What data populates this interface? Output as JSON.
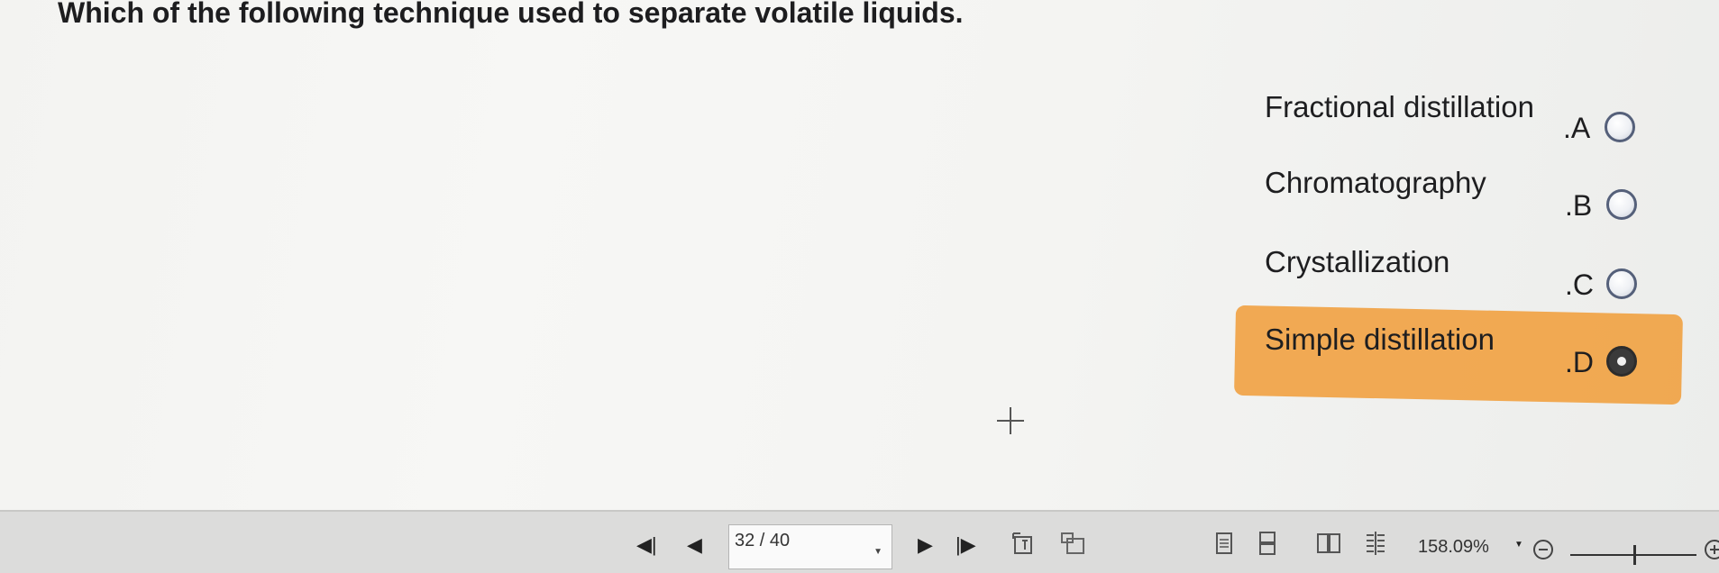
{
  "question": "Which of the following technique used to separate volatile liquids.",
  "options": [
    {
      "text": "Fractional distillation",
      "letter": ".A",
      "selected": false
    },
    {
      "text": "Chromatography",
      "letter": ".B",
      "selected": false
    },
    {
      "text": "Crystallization",
      "letter": ".C",
      "selected": false
    },
    {
      "text": "Simple distillation",
      "letter": ".D",
      "selected": true
    }
  ],
  "toolbar": {
    "first_page": "◀|",
    "prev_page": "◀",
    "page_indicator": "32 / 40",
    "next_page": "▶",
    "last_page": "|▶",
    "zoom": "158.09%"
  },
  "colors": {
    "highlight": "#f0a44a",
    "radio_border": "#55607a"
  }
}
